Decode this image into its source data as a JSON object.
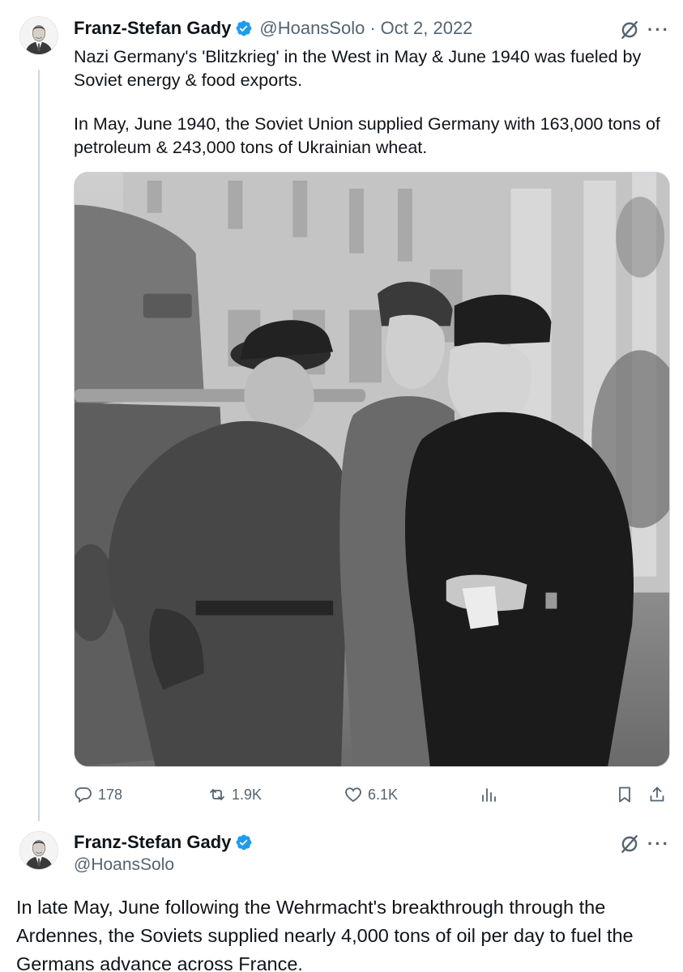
{
  "tweet1": {
    "author_name": "Franz-Stefan Gady",
    "handle": "@HoansSolo",
    "separator": "·",
    "date": "Oct 2, 2022",
    "more_label": "···",
    "paragraphs": [
      "Nazi Germany's 'Blitzkrieg' in the West in May & June 1940 was fueled by Soviet energy & food exports.",
      "In May, June 1940, the Soviet Union supplied Germany with 163,000 tons of petroleum & 243,000 tons of Ukrainian wheat."
    ],
    "stats": {
      "replies": "178",
      "reposts": "1.9K",
      "likes": "6.1K"
    }
  },
  "tweet2": {
    "author_name": "Franz-Stefan Gady",
    "handle": "@HoansSolo",
    "more_label": "···",
    "text": "In late May, June following the Wehrmacht's breakthrough through the Ardennes, the Soviets supplied nearly 4,000 tons of oil per day to fuel the Germans advance across France."
  },
  "colors": {
    "text": "#0f1419",
    "secondary": "#536471",
    "verified": "#1d9bf0",
    "border": "#cfd9de"
  },
  "icons": {
    "verified": "verified-badge-icon",
    "grok": "grok-icon",
    "more": "more-icon",
    "reply": "reply-icon",
    "repost": "repost-icon",
    "like": "like-icon",
    "views": "views-icon",
    "bookmark": "bookmark-icon",
    "share": "share-icon"
  }
}
